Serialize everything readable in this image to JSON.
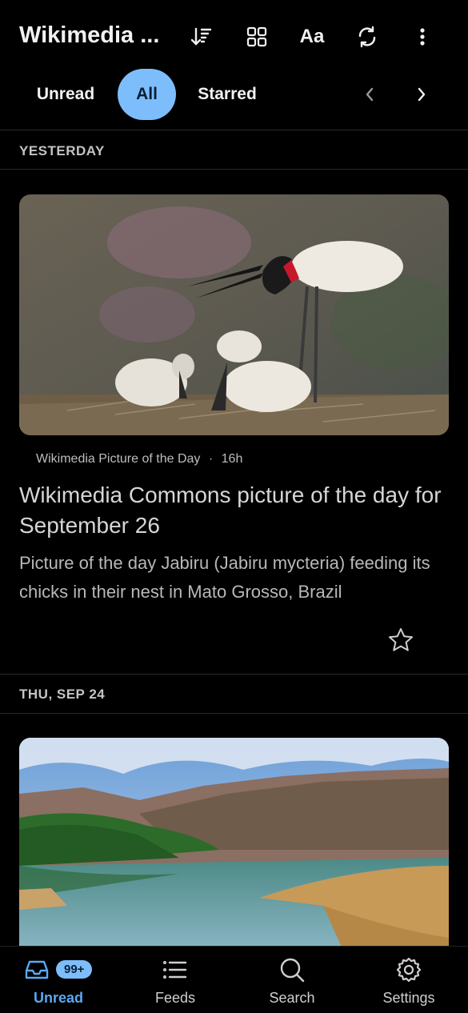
{
  "header": {
    "title": "Wikimedia ...",
    "font_label": "Aa",
    "icons": [
      "sort-icon",
      "grid-icon",
      "font-size-icon",
      "refresh-icon",
      "more-vert-icon"
    ]
  },
  "filters": {
    "tabs": [
      {
        "label": "Unread",
        "selected": false
      },
      {
        "label": "All",
        "selected": true
      },
      {
        "label": "Starred",
        "selected": false
      }
    ]
  },
  "sections": [
    {
      "label": "YESTERDAY",
      "article": {
        "source": "Wikimedia Picture of the Day",
        "age": "16h",
        "separator": "·",
        "title": "Wikimedia Commons picture of the day for September 26",
        "description": "Picture of the day Jabiru (Jabiru mycteria) feeding its chicks in their nest in Mato Grosso, Brazil",
        "starred": false
      }
    },
    {
      "label": "THU, SEP 24"
    }
  ],
  "bottom_nav": {
    "items": [
      {
        "label": "Unread",
        "icon": "inbox-icon",
        "active": true,
        "badge": "99+"
      },
      {
        "label": "Feeds",
        "icon": "list-icon",
        "active": false
      },
      {
        "label": "Search",
        "icon": "search-icon",
        "active": false
      },
      {
        "label": "Settings",
        "icon": "gear-icon",
        "active": false
      }
    ]
  },
  "colors": {
    "accent": "#7dbdfc",
    "accent_text": "#5ba8f5",
    "background": "#000000"
  }
}
